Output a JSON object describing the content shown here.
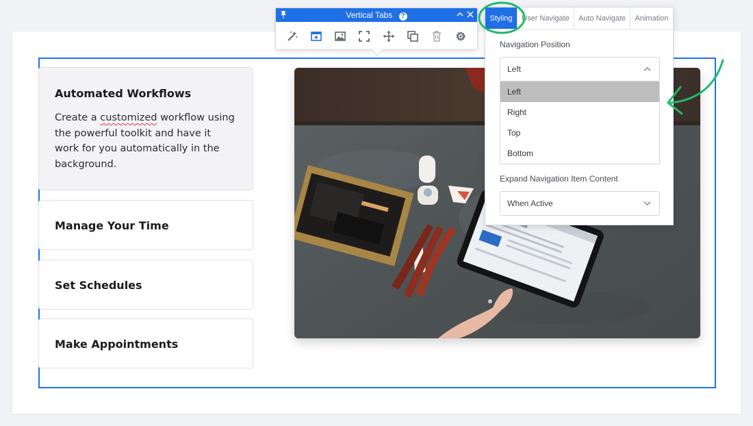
{
  "toolbar": {
    "title": "Vertical Tabs",
    "help_icon": "help-circle-icon",
    "tools": [
      "magic-wand-icon",
      "add-tab-icon",
      "image-icon",
      "fullscreen-icon",
      "move-icon",
      "duplicate-icon",
      "trash-icon",
      "gear-icon"
    ]
  },
  "panel": {
    "tabs": [
      "Styling",
      "User Navigate",
      "Auto Navigate",
      "Animation"
    ],
    "active_tab": "Styling",
    "nav_position_label": "Navigation Position",
    "nav_position_value": "Left",
    "nav_position_options": [
      "Left",
      "Right",
      "Top",
      "Bottom"
    ],
    "expand_label": "Expand Navigation Item Content",
    "expand_value": "When Active"
  },
  "tabs": [
    {
      "title": "Automated Workflows",
      "desc_before": "Create a ",
      "desc_misspelled": "customized",
      "desc_after": " workflow using the powerful toolkit and have it work for you automatically in the background."
    },
    {
      "title": "Manage Your Time"
    },
    {
      "title": "Set Schedules"
    },
    {
      "title": "Make Appointments"
    }
  ],
  "colors": {
    "accent": "#1f6fe5",
    "annotation": "#1fb86b",
    "highlight": "#bdbdbd"
  }
}
